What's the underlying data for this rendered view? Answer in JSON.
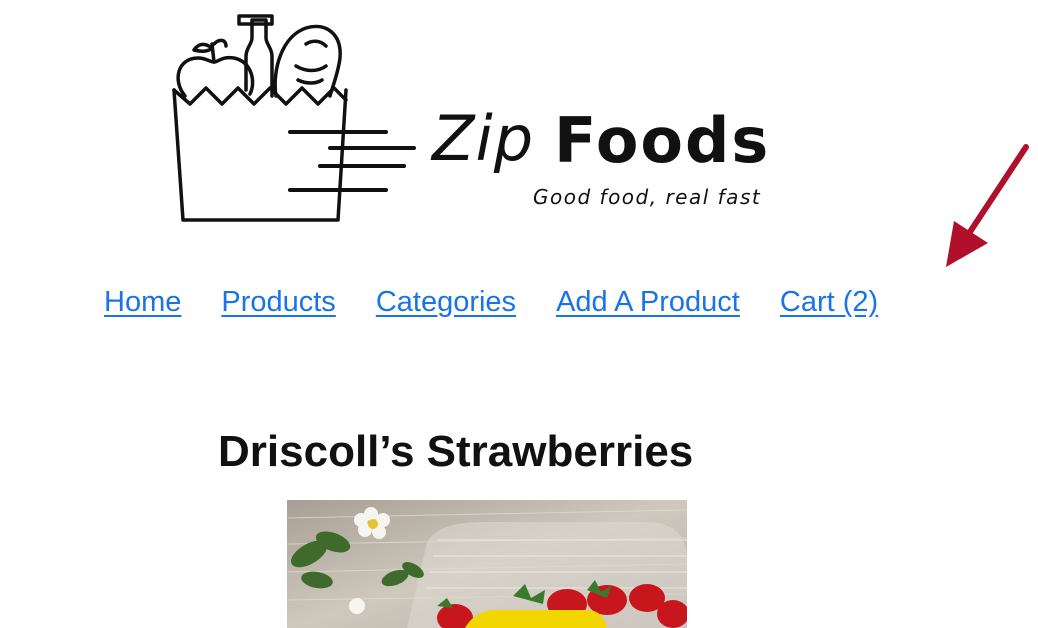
{
  "brand": {
    "name_part1": "Zip",
    "name_part2": "Foods",
    "tagline": "Good food, real fast"
  },
  "nav": {
    "items": [
      {
        "label": "Home"
      },
      {
        "label": "Products"
      },
      {
        "label": "Categories"
      },
      {
        "label": "Add A Product"
      },
      {
        "label": "Cart (2)"
      }
    ]
  },
  "product": {
    "title": "Driscoll’s Strawberries"
  },
  "colors": {
    "link": "#1a73e8",
    "arrow": "#b0102b",
    "text": "#111111"
  },
  "icons": {
    "logo": "grocery-bag-icon",
    "annotation": "red-arrow-icon"
  }
}
